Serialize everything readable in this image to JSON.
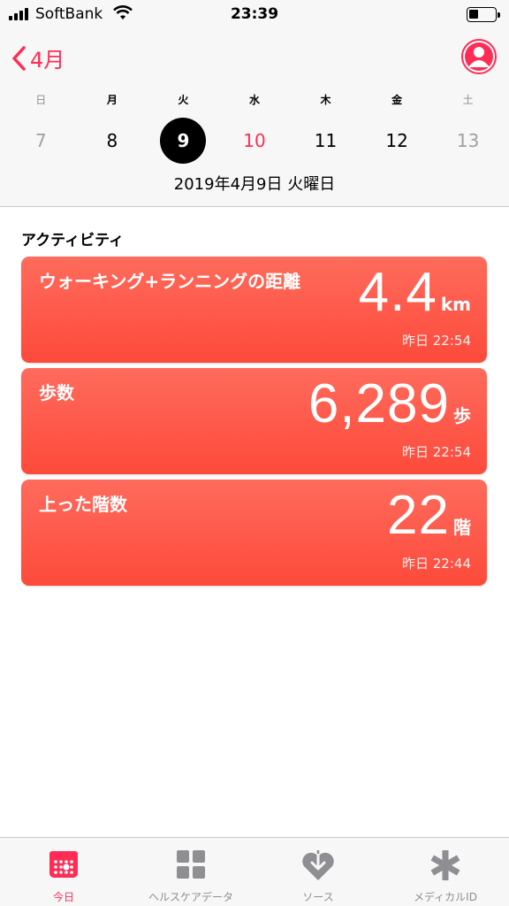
{
  "status": {
    "carrier": "SoftBank",
    "time": "23:39"
  },
  "header": {
    "back_label": "4月",
    "weekdays": [
      "日",
      "月",
      "火",
      "水",
      "木",
      "金",
      "土"
    ],
    "days": [
      "7",
      "8",
      "9",
      "10",
      "11",
      "12",
      "13"
    ],
    "selected_day_index": 2,
    "date_label": "2019年4月9日 火曜日"
  },
  "section": {
    "title": "アクティビティ"
  },
  "cards": [
    {
      "title": "ウォーキング+ランニングの距離",
      "value": "4.4",
      "unit": "km",
      "time": "昨日 22:54"
    },
    {
      "title": "歩数",
      "value": "6,289",
      "unit": "歩",
      "time": "昨日 22:54"
    },
    {
      "title": "上った階数",
      "value": "22",
      "unit": "階",
      "time": "昨日 22:44"
    }
  ],
  "tabs": [
    {
      "label": "今日",
      "icon": "today-calendar-icon"
    },
    {
      "label": "ヘルスケアデータ",
      "icon": "health-data-grid-icon"
    },
    {
      "label": "ソース",
      "icon": "sources-heart-icon"
    },
    {
      "label": "メディカルID",
      "icon": "medical-id-asterisk-icon"
    }
  ],
  "colors": {
    "accent": "#ff2d55",
    "card_top": "#fe6b5c",
    "card_bottom": "#fd4a3b",
    "muted": "#8e8e93"
  }
}
